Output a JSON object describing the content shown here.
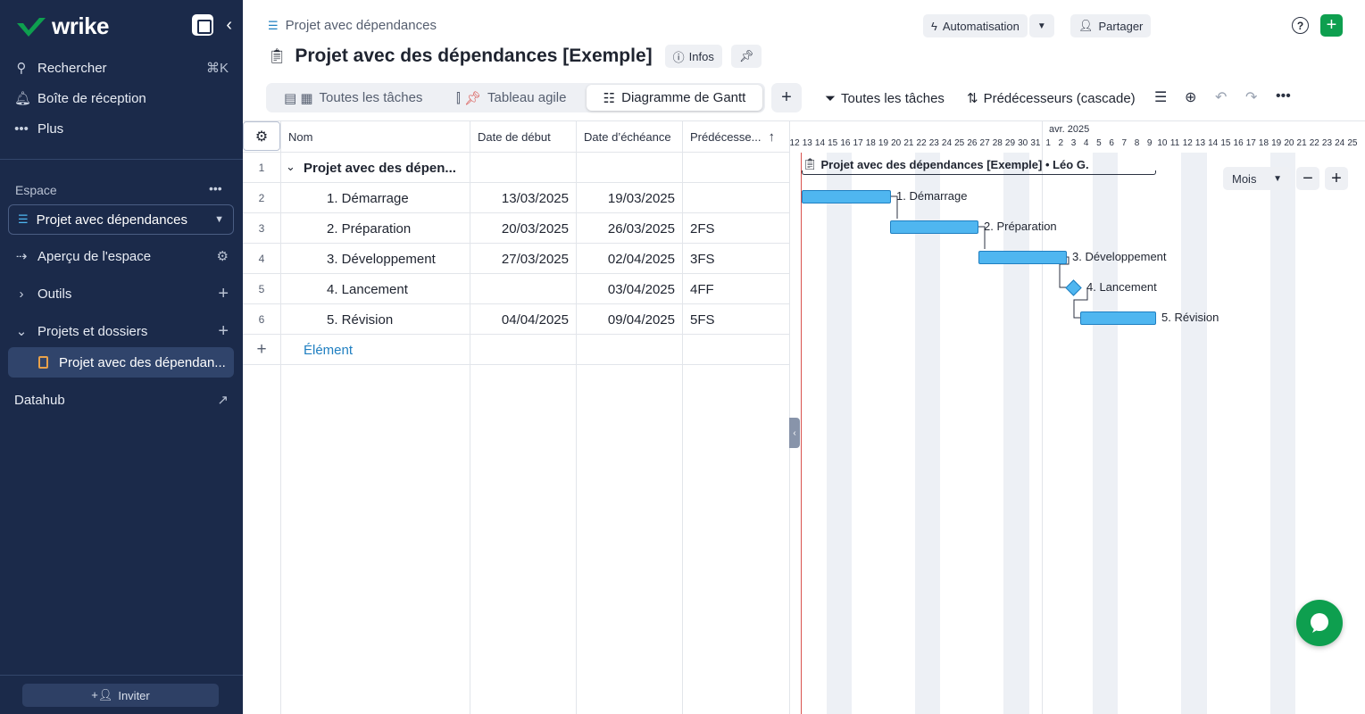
{
  "app": {
    "logo_text": "wrike",
    "brand_color": "#0e9f4f",
    "sidebar_bg": "#1b2a4a"
  },
  "sidebar": {
    "search_label": "Rechercher",
    "search_shortcut": "⌘K",
    "inbox_label": "Boîte de réception",
    "more_label": "Plus",
    "space_section_label": "Espace",
    "space_select": "Projet avec dépendances",
    "space_overview": "Aperçu de l'espace",
    "tools_label": "Outils",
    "projects_label": "Projets et dossiers",
    "active_project": "Projet avec des dépendan...",
    "datahub_label": "Datahub",
    "invite_label": "Inviter"
  },
  "header": {
    "breadcrumb": "Projet avec dépendances",
    "title": "Projet avec des dépendances [Exemple]",
    "info_label": "Infos",
    "automation_label": "Automatisation",
    "share_label": "Partager"
  },
  "views": {
    "tabs": [
      {
        "label": "Toutes les tâches",
        "icon": "table-icon"
      },
      {
        "label": "Tableau agile",
        "icon": "board-icon"
      },
      {
        "label": "Diagramme de Gantt",
        "icon": "gantt-icon",
        "active": true
      }
    ],
    "filter_label": "Toutes les tâches",
    "sort_label": "Prédécesseurs (cascade)"
  },
  "grid": {
    "columns": [
      "Nom",
      "Date de début",
      "Date d’échéance",
      "Prédécesse..."
    ],
    "rows": [
      {
        "num": "1",
        "name": "Projet avec des dépen...",
        "start": "",
        "due": "",
        "pred": ""
      },
      {
        "num": "2",
        "name": "1. Démarrage",
        "start": "13/03/2025",
        "due": "19/03/2025",
        "pred": ""
      },
      {
        "num": "3",
        "name": "2. Préparation",
        "start": "20/03/2025",
        "due": "26/03/2025",
        "pred": "2FS"
      },
      {
        "num": "4",
        "name": "3. Développement",
        "start": "27/03/2025",
        "due": "02/04/2025",
        "pred": "3FS"
      },
      {
        "num": "5",
        "name": "4. Lancement",
        "start": "",
        "due": "03/04/2025",
        "pred": "4FF"
      },
      {
        "num": "6",
        "name": "5. Révision",
        "start": "04/04/2025",
        "due": "09/04/2025",
        "pred": "5FS"
      }
    ],
    "add_label": "Élément"
  },
  "gantt": {
    "month_label": "avr. 2025",
    "days": [
      "12",
      "13",
      "14",
      "15",
      "16",
      "17",
      "18",
      "19",
      "20",
      "21",
      "22",
      "23",
      "24",
      "25",
      "26",
      "27",
      "28",
      "29",
      "30",
      "31",
      "1",
      "2",
      "3",
      "4",
      "5",
      "6",
      "7",
      "8",
      "9",
      "10",
      "11",
      "12",
      "13",
      "14",
      "15",
      "16",
      "17",
      "18",
      "19",
      "20",
      "21",
      "22",
      "23",
      "24",
      "25"
    ],
    "project_label": "Projet avec des dépendances [Exemple] • Léo G.",
    "zoom_label": "Mois",
    "bar_color": "#4fb6f0",
    "tasks": [
      {
        "label": "1. Démarrage"
      },
      {
        "label": "2. Préparation"
      },
      {
        "label": "3. Développement"
      },
      {
        "label": "4. Lancement"
      },
      {
        "label": "5. Révision"
      }
    ]
  }
}
